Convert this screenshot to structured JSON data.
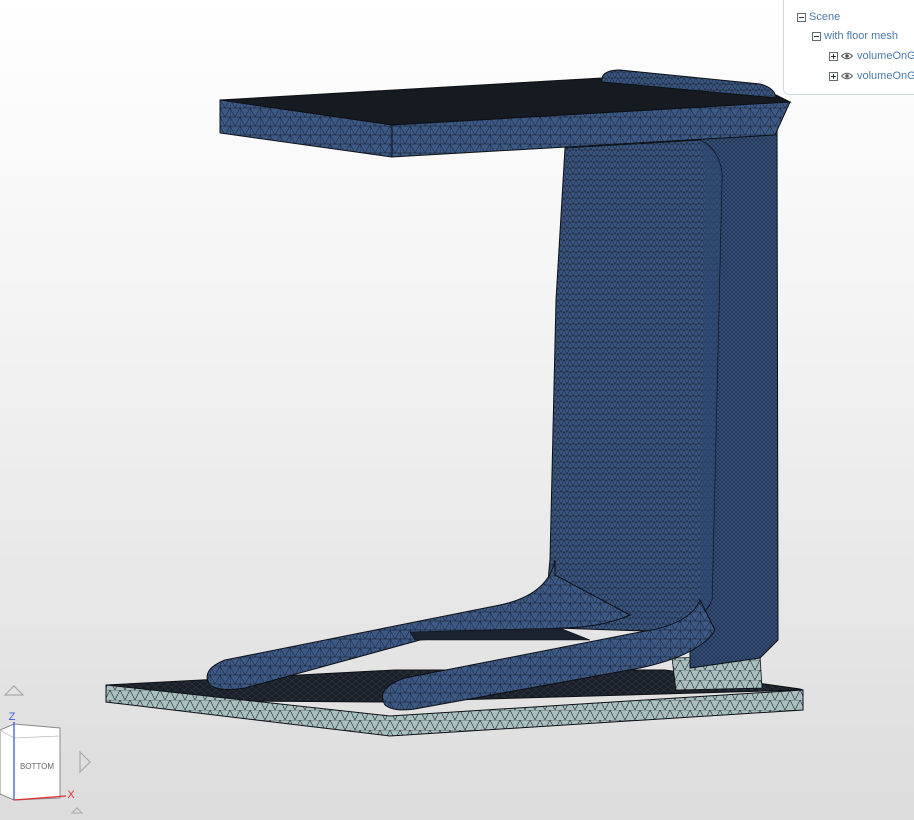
{
  "scene_tree": {
    "root": {
      "label": "Scene",
      "expanded": true
    },
    "group": {
      "label": "with floor mesh",
      "expanded": true
    },
    "items": [
      {
        "label": "volumeOnG",
        "visible": true,
        "expanded": false,
        "icon": "eye-icon"
      },
      {
        "label": "volumeOnG",
        "visible": true,
        "expanded": false,
        "icon": "eye-icon"
      }
    ]
  },
  "nav_cube": {
    "face_label": "BOTTOM",
    "axis_z": "Z",
    "axis_x": "X",
    "colors": {
      "z_axis": "#3b5bdb",
      "x_axis": "#e03131"
    }
  },
  "model": {
    "part_color": "#3d5a86",
    "floor_color": "#a9bfc0",
    "edge_color": "#0d1016"
  }
}
